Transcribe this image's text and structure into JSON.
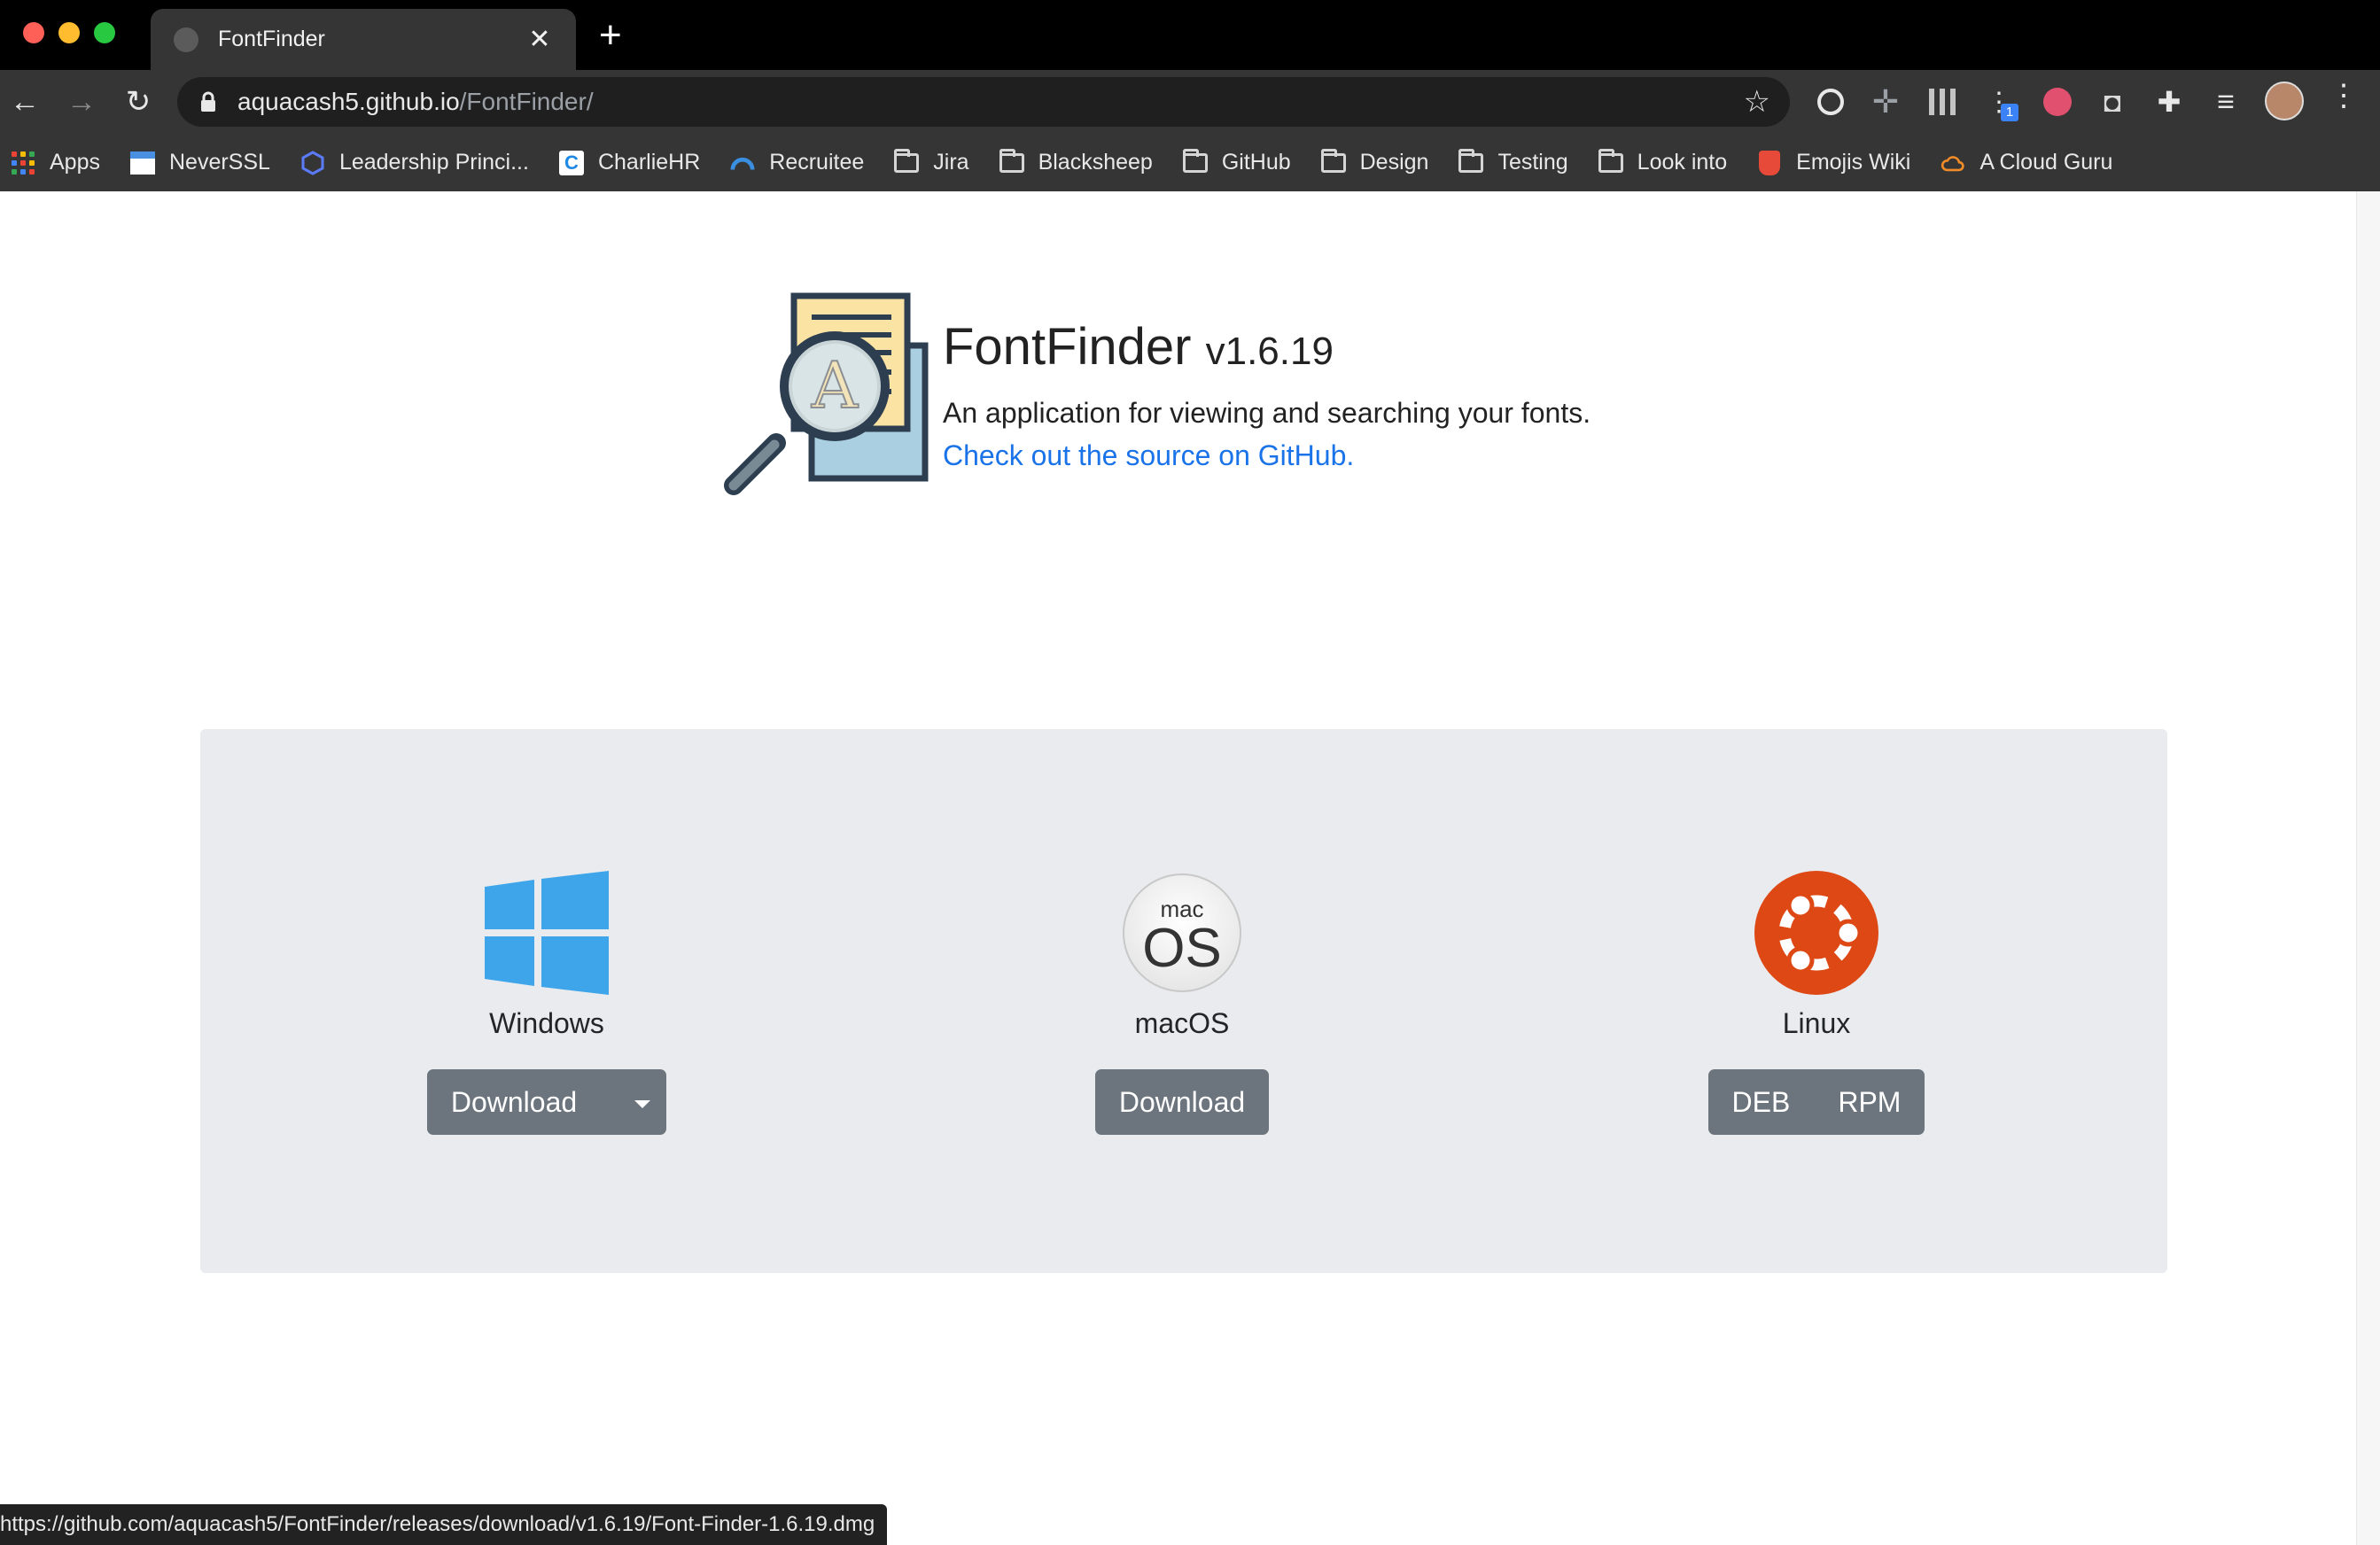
{
  "browser": {
    "tab": {
      "title": "FontFinder"
    },
    "url": {
      "host": "aquacash5.github.io",
      "path": "/FontFinder/"
    },
    "bookmarks": [
      {
        "label": "Apps",
        "icon": "apps-grid-icon"
      },
      {
        "label": "NeverSSL",
        "icon": "neverssl-icon"
      },
      {
        "label": "Leadership Princi...",
        "icon": "hexagon-icon"
      },
      {
        "label": "CharlieHR",
        "icon": "charliehr-icon"
      },
      {
        "label": "Recruitee",
        "icon": "recruitee-icon"
      },
      {
        "label": "Jira",
        "icon": "folder-icon"
      },
      {
        "label": "Blacksheep",
        "icon": "folder-icon"
      },
      {
        "label": "GitHub",
        "icon": "folder-icon"
      },
      {
        "label": "Design",
        "icon": "folder-icon"
      },
      {
        "label": "Testing",
        "icon": "folder-icon"
      },
      {
        "label": "Look into",
        "icon": "folder-icon"
      },
      {
        "label": "Emojis Wiki",
        "icon": "emoji-icon"
      },
      {
        "label": "A Cloud Guru",
        "icon": "cloud-icon"
      }
    ],
    "extensions": {
      "badge_count": "1"
    },
    "status_url": "https://github.com/aquacash5/FontFinder/releases/download/v1.6.19/Font-Finder-1.6.19.dmg"
  },
  "app": {
    "name": "FontFinder",
    "version": "v1.6.19",
    "description": "An application for viewing and searching your fonts.",
    "source_link": "Check out the source on GitHub."
  },
  "platforms": {
    "windows": {
      "name": "Windows",
      "download": "Download"
    },
    "macos": {
      "name": "macOS",
      "download": "Download",
      "icon_small": "mac",
      "icon_big": "OS"
    },
    "linux": {
      "name": "Linux",
      "deb": "DEB",
      "rpm": "RPM"
    }
  },
  "colors": {
    "link": "#1a73e8",
    "button": "#6c757d",
    "panel": "#e9ebee",
    "windows_blue": "#3ea5ea",
    "ubuntu_orange": "#dd4814"
  }
}
